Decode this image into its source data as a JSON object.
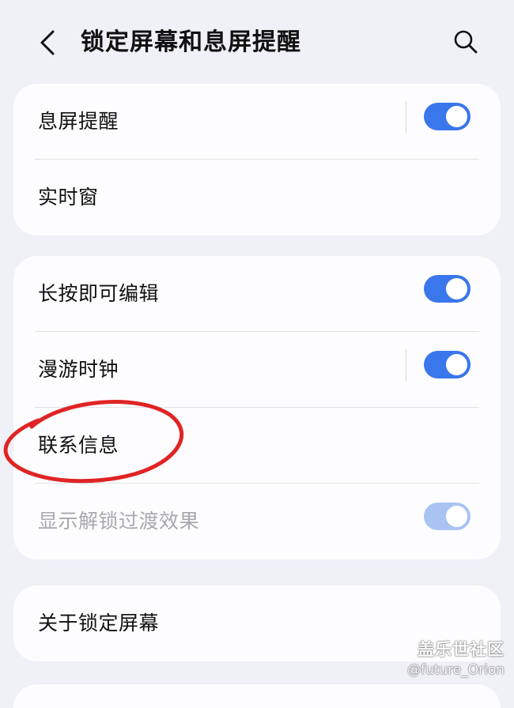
{
  "header": {
    "title": "锁定屏幕和息屏提醒",
    "back_icon": "chevron-left-icon",
    "search_icon": "search-icon"
  },
  "group1": {
    "items": [
      {
        "label": "息屏提醒",
        "toggle": "on"
      },
      {
        "label": "实时窗"
      }
    ]
  },
  "group2": {
    "items": [
      {
        "label": "长按即可编辑",
        "toggle": "on"
      },
      {
        "label": "漫游时钟",
        "toggle": "on"
      },
      {
        "label": "联系信息"
      },
      {
        "label": "显示解锁过渡效果",
        "toggle": "on",
        "disabled": true
      }
    ]
  },
  "group3": {
    "items": [
      {
        "label": "关于锁定屏幕"
      }
    ]
  },
  "annotation": {
    "color": "#e02424"
  },
  "watermark": {
    "brand": "盖乐世社区",
    "user": "@future_Orion"
  },
  "colors": {
    "background": "#f0f0f7",
    "card": "#fdfdff",
    "toggle_on": "#3a76ec",
    "toggle_disabled": "#a9c4f3"
  }
}
